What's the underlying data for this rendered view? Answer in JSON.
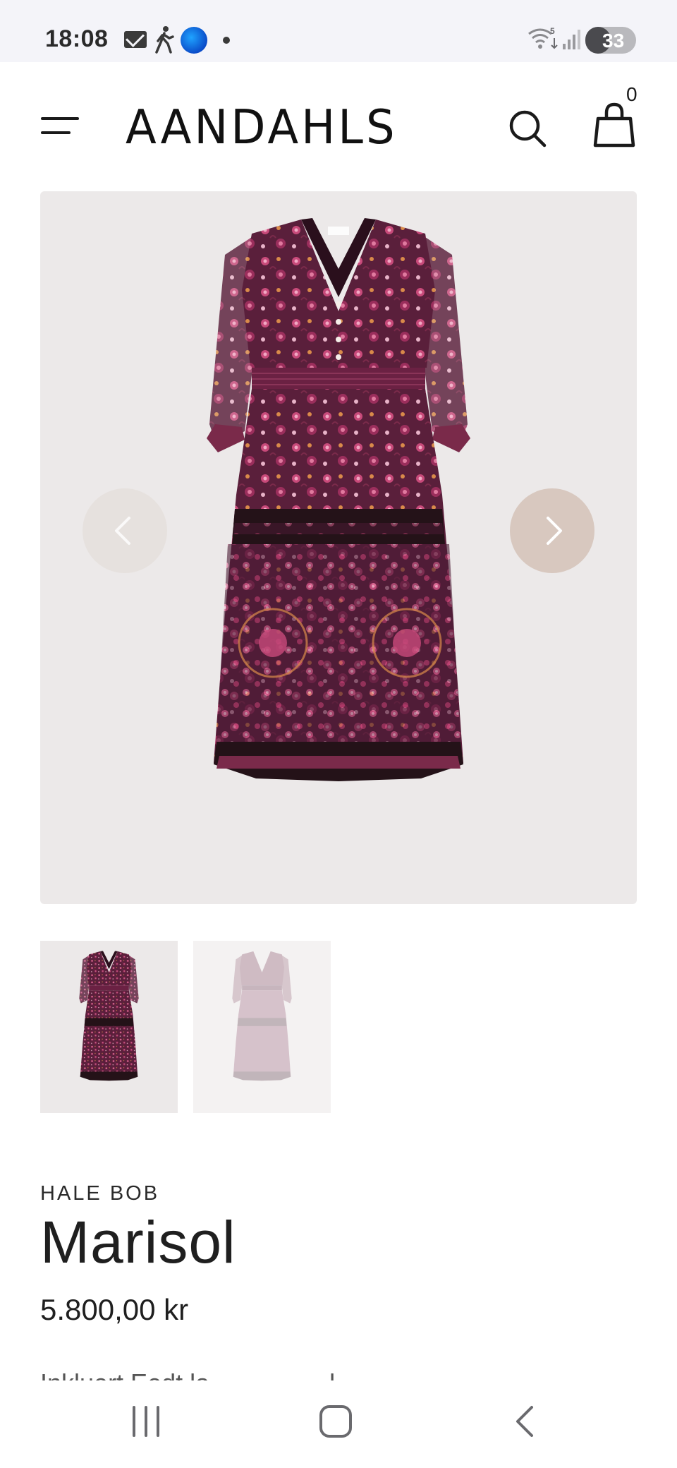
{
  "status_bar": {
    "time": "18:08",
    "battery": "33",
    "icons": [
      "mail-icon",
      "walking-icon",
      "app-icon",
      "dot-icon",
      "wifi-icon",
      "signal-icon",
      "battery-icon"
    ]
  },
  "header": {
    "logo": "AANDAHLS",
    "cart_count": "0",
    "icons": [
      "menu-icon",
      "search-icon",
      "cart-icon"
    ]
  },
  "gallery": {
    "main_image": "patterned-maxi-dress",
    "thumbnails": [
      "dress-front-thumbnail",
      "dress-faded-thumbnail"
    ],
    "prev_arrow": "chevron-left-icon",
    "next_arrow": "chevron-right-icon"
  },
  "product": {
    "brand": "HALE BOB",
    "title": "Marisol",
    "price": "5.800,00 kr",
    "description_partial": "Inkluert Eedt la ... ... ... ... l..."
  },
  "system_nav": {
    "icons": [
      "recent-apps-icon",
      "home-icon",
      "back-icon"
    ]
  },
  "colors": {
    "dress_base": "#5a1f3b",
    "dress_accent": "#c84a7a",
    "image_bg": "#ece9e9",
    "arrow_bg": "#d8c8bf"
  }
}
